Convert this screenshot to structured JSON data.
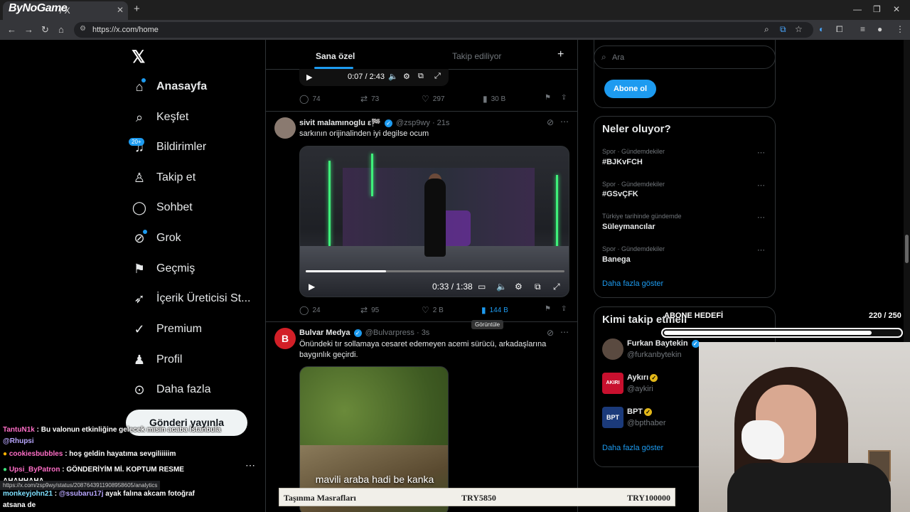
{
  "browser": {
    "tab_logo": "ByNoGame",
    "tab_title": "/ X",
    "tab_close": "✕",
    "new_tab": "+",
    "url": "https://x.com/home"
  },
  "sidebar": {
    "logo": "𝕏",
    "items": [
      {
        "label": "Anasayfa",
        "icon": "home-icon"
      },
      {
        "label": "Keşfet",
        "icon": "search-icon"
      },
      {
        "label": "Bildirimler",
        "icon": "bell-icon"
      },
      {
        "label": "Takip et",
        "icon": "follow-icon"
      },
      {
        "label": "Sohbet",
        "icon": "chat-icon"
      },
      {
        "label": "Grok",
        "icon": "grok-icon"
      },
      {
        "label": "Geçmiş",
        "icon": "bookmark-icon"
      },
      {
        "label": "İçerik Üreticisi St...",
        "icon": "rocket-icon"
      },
      {
        "label": "Premium",
        "icon": "premium-icon"
      },
      {
        "label": "Profil",
        "icon": "profile-icon"
      },
      {
        "label": "Daha fazla",
        "icon": "more-icon"
      }
    ],
    "notif_badge": "20+",
    "post_button": "Gönderi yayınla"
  },
  "feed": {
    "tabs": [
      "Sana özel",
      "Takip ediliyor"
    ],
    "prev_post": {
      "time": "0:07 / 2:43",
      "replies": "74",
      "reposts": "73",
      "likes": "297",
      "views": "30 B"
    },
    "post1": {
      "name": "sivit malamınoglu ε🏁",
      "handle": "@zsp9wy",
      "time": "· 21s",
      "text": "sarkının orijinalinden iyi degilse ocum",
      "video_time": "0:33 / 1:38",
      "progress": 0.31,
      "replies": "24",
      "reposts": "95",
      "likes": "2 B",
      "views": "144 B",
      "tooltip": "Görüntüle"
    },
    "post2": {
      "avatar": "B",
      "name": "Bulvar Medya",
      "handle": "@Bulvarpress",
      "time": "· 3s",
      "text": "Önündeki tır sollamaya cesaret edemeyen acemi sürücü, arkadaşlarına baygınlık geçirdi.",
      "caption": "mavili araba hadi be kanka"
    }
  },
  "right": {
    "search_placeholder": "Ara",
    "subscribe_button": "Abone ol",
    "trends_title": "Neler oluyor?",
    "trends": [
      {
        "category": "Spor · Gündemdekiler",
        "name": "#BJKvFCH"
      },
      {
        "category": "Spor · Gündemdekiler",
        "name": "#GSvÇFK"
      },
      {
        "category": "Türkiye tarihinde gündemde",
        "name": "Süleymancılar"
      },
      {
        "category": "Spor · Gündemdekiler",
        "name": "Banega"
      }
    ],
    "show_more": "Daha fazla göster",
    "follow_title": "Kimi takip etmeli",
    "follows": [
      {
        "name": "Furkan Baytekin",
        "handle": "@furkanbytekin",
        "badge": "blue"
      },
      {
        "name": "Aykırı",
        "handle": "@aykiri",
        "badge": "gold",
        "avatar_text": "AKIRI"
      },
      {
        "name": "BPT",
        "handle": "@bpthaber",
        "badge": "gold",
        "avatar_text": "BPT"
      }
    ],
    "follow_show_more": "Daha fazla göster"
  },
  "stream": {
    "goal_label": "ABONE HEDEFİ",
    "goal_count": "220 / 250",
    "goal_fraction": 0.88,
    "chat": [
      {
        "user": "TantuN1k",
        "color": "#ff6ec7",
        "msg": ": Bu valonun etkinliğine gelecek misin acaba İstanbula",
        "mention": "@Rhupsi"
      },
      {
        "user": "cookiesbubbles",
        "color": "#ff6ec7",
        "msg": ": hoş geldin hayatıma sevgiliiiiim",
        "mention": ""
      },
      {
        "user": "Upsi_ByPatron",
        "color": "#ff6ec7",
        "msg": ": GÖNDERİYİM Mİ. KOPTUM RESME AHAHHAHA",
        "mention": ""
      },
      {
        "user": "monkeyjohn21",
        "color": "#7ee0ff",
        "msg": "ayak falına akcam fotoğraf atsana de",
        "mention": "@ssubaru17j"
      }
    ],
    "status_url": "https://x.com/zsp9wy/status/2087643911908958605/analytics",
    "ticker": {
      "label": "Taşınma Masrafları",
      "current": "TRY5850",
      "target": "TRY100000"
    }
  }
}
